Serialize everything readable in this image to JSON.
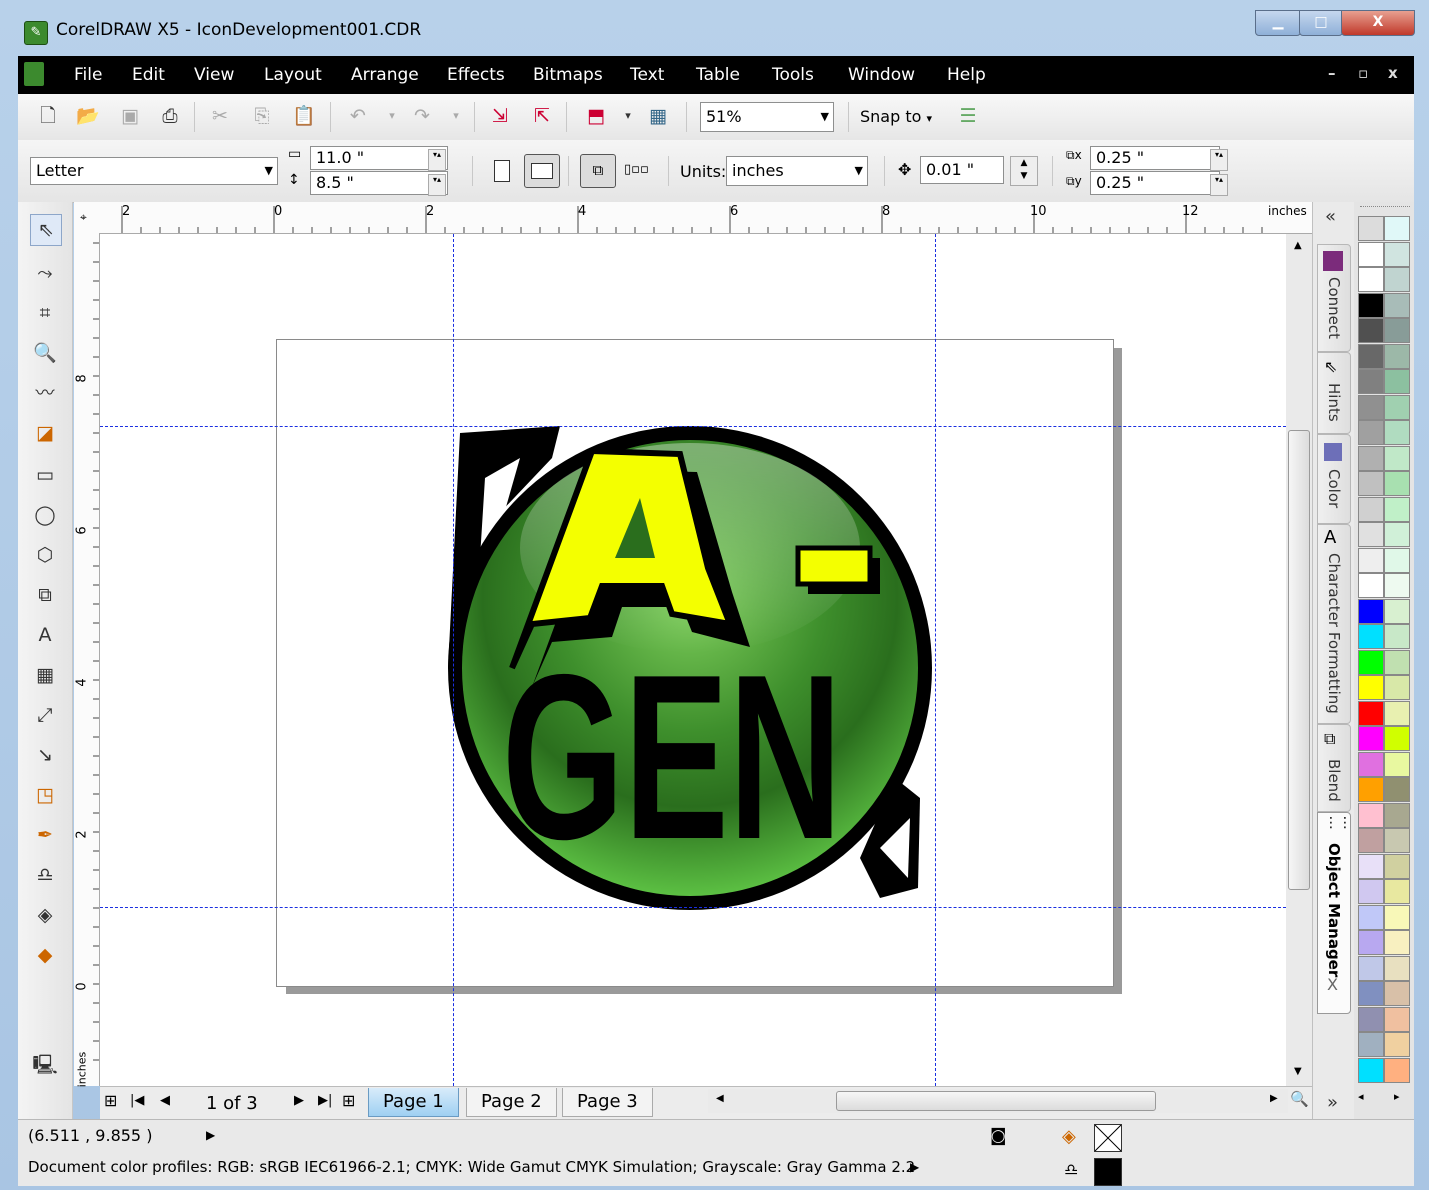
{
  "window": {
    "title": "CorelDRAW X5 - IconDevelopment001.CDR",
    "min_glyph": "▁",
    "max_glyph": "□",
    "close_glyph": "X"
  },
  "menu": {
    "items": [
      "File",
      "Edit",
      "View",
      "Layout",
      "Arrange",
      "Effects",
      "Bitmaps",
      "Text",
      "Table",
      "Tools",
      "Window",
      "Help"
    ],
    "mdi_controls": [
      "–",
      "▫",
      "x"
    ]
  },
  "toolbar": {
    "zoom": "51%",
    "snap_to": "Snap to"
  },
  "property_bar": {
    "paper_size": "Letter",
    "page_width": "11.0 \"",
    "page_height": "8.5 \"",
    "units_label": "Units:",
    "units_value": "inches",
    "nudge": "0.01 \"",
    "dup_x": "0.25 \"",
    "dup_y": "0.25 \""
  },
  "rulers": {
    "h_labels": [
      "2",
      "0",
      "2",
      "4",
      "6",
      "8",
      "10",
      "12"
    ],
    "h_unit": "inches",
    "v_labels": [
      "8",
      "6",
      "4",
      "2",
      "0"
    ],
    "v_unit": "inches"
  },
  "dockers": {
    "collapse": "«",
    "tabs": [
      "Connect",
      "Hints",
      "Color",
      "Character Formatting",
      "Blend",
      "Object Manager"
    ],
    "close": "X",
    "expand": "»"
  },
  "palette": {
    "colors": [
      [
        "#dcdcdc",
        "#e0f8f8"
      ],
      [
        "#ffffff",
        "#d0e4e0"
      ],
      [
        "#ffffff",
        "#c0d4d0"
      ],
      [
        "#000000",
        "#a8bcb8"
      ],
      [
        "#505050",
        "#889c98"
      ],
      [
        "#686868",
        "#9cb8a8"
      ],
      [
        "#808080",
        "#8cc0a0"
      ],
      [
        "#909090",
        "#a0d0b0"
      ],
      [
        "#a0a0a0",
        "#b0dcc0"
      ],
      [
        "#b0b0b0",
        "#c0e8c8"
      ],
      [
        "#c0c0c0",
        "#a8e0b0"
      ],
      [
        "#d0d0d0",
        "#c0f0c8"
      ],
      [
        "#e0e0e0",
        "#d0f0d8"
      ],
      [
        "#eeeeee",
        "#e0f8e8"
      ],
      [
        "#ffffff",
        "#eefaf0"
      ],
      [
        "#0000ff",
        "#d8f0d0"
      ],
      [
        "#00e0ff",
        "#c8e8c8"
      ],
      [
        "#00ff00",
        "#c0e0b0"
      ],
      [
        "#ffff00",
        "#d8e8a8"
      ],
      [
        "#ff0000",
        "#e8f0b0"
      ],
      [
        "#ff00ff",
        "#d0ff00"
      ],
      [
        "#e070e0",
        "#e8f8a0"
      ],
      [
        "#ffa000",
        "#909070"
      ],
      [
        "#ffc0d0",
        "#a8a890"
      ],
      [
        "#c0a0a0",
        "#c8c8b0"
      ],
      [
        "#e8e0f8",
        "#d0d0a0"
      ],
      [
        "#d0c8f0",
        "#e8e8a0"
      ],
      [
        "#c0c8f8",
        "#f8f8b8"
      ],
      [
        "#b8a8f0",
        "#f8f0c0"
      ],
      [
        "#c0c8e8",
        "#e8e0c0"
      ],
      [
        "#8090c0",
        "#d8c0a8"
      ],
      [
        "#9090b0",
        "#f0c0a0"
      ],
      [
        "#a0b0c0",
        "#f0d0a0"
      ],
      [
        "#00e0ff",
        "#ffb080"
      ]
    ]
  },
  "page_nav": {
    "page_count": "1 of 3",
    "tabs": [
      "Page 1",
      "Page 2",
      "Page 3"
    ]
  },
  "status": {
    "coords": "(6.511 , 9.855 )",
    "profiles": "Document color profiles: RGB: sRGB IEC61966-2.1; CMYK: Wide Gamut CMYK Simulation; Grayscale: Gray Gamma 2.2",
    "fill_color": "#000000"
  },
  "artwork": {
    "top_text": "A-",
    "bottom_text": "GEN",
    "accent_yellow": "#f4ff00",
    "circle_green": "#3e8f2c"
  }
}
